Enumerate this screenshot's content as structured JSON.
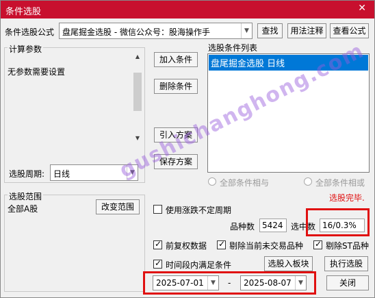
{
  "window": {
    "title": "条件选股",
    "close_glyph": "✕"
  },
  "formula": {
    "label": "条件选股公式",
    "selected": "盘尾掘金选股  -  微信公众号：股海操作手",
    "find_button": "查找",
    "usage_button": "用法注释",
    "view_button": "查看公式"
  },
  "params": {
    "group_label": "计算参数",
    "text": "无参数需要设置",
    "period_label": "选股周期:",
    "period_value": "日线"
  },
  "actions": {
    "add": "加入条件",
    "delete": "删除条件",
    "import": "引入方案",
    "save": "保存方案"
  },
  "conditions": {
    "label": "选股条件列表",
    "items": [
      "盘尾掘金选股  日线"
    ],
    "and_label": "全部条件相与",
    "or_label": "全部条件相或",
    "status": "选股完毕."
  },
  "range": {
    "group_label": "选股范围",
    "value": "全部A股",
    "change_button": "改变范围"
  },
  "options": {
    "volatile_period_label": "使用涨跌不定周期",
    "count_label": "品种数",
    "count_value": "5424",
    "selected_label": "选中数",
    "selected_value": "16/0.3%",
    "pre_adjust_label": "前复权数据",
    "exclude_untraded_label": "剔除当前未交易品种",
    "exclude_st_label": "剔除ST品种",
    "period_condition_label": "时间段内满足条件",
    "to_block_button": "选股入板块",
    "execute_button": "执行选股",
    "close_button": "关闭",
    "date_from": "2025-07-01",
    "date_sep": "-",
    "date_to": "2025-08-07"
  },
  "watermark": "gushichanghong.com",
  "colors": {
    "title_bar": "#c8102e",
    "selection": "#0078d7",
    "status": "#e01010",
    "highlight_box": "#e01010"
  }
}
